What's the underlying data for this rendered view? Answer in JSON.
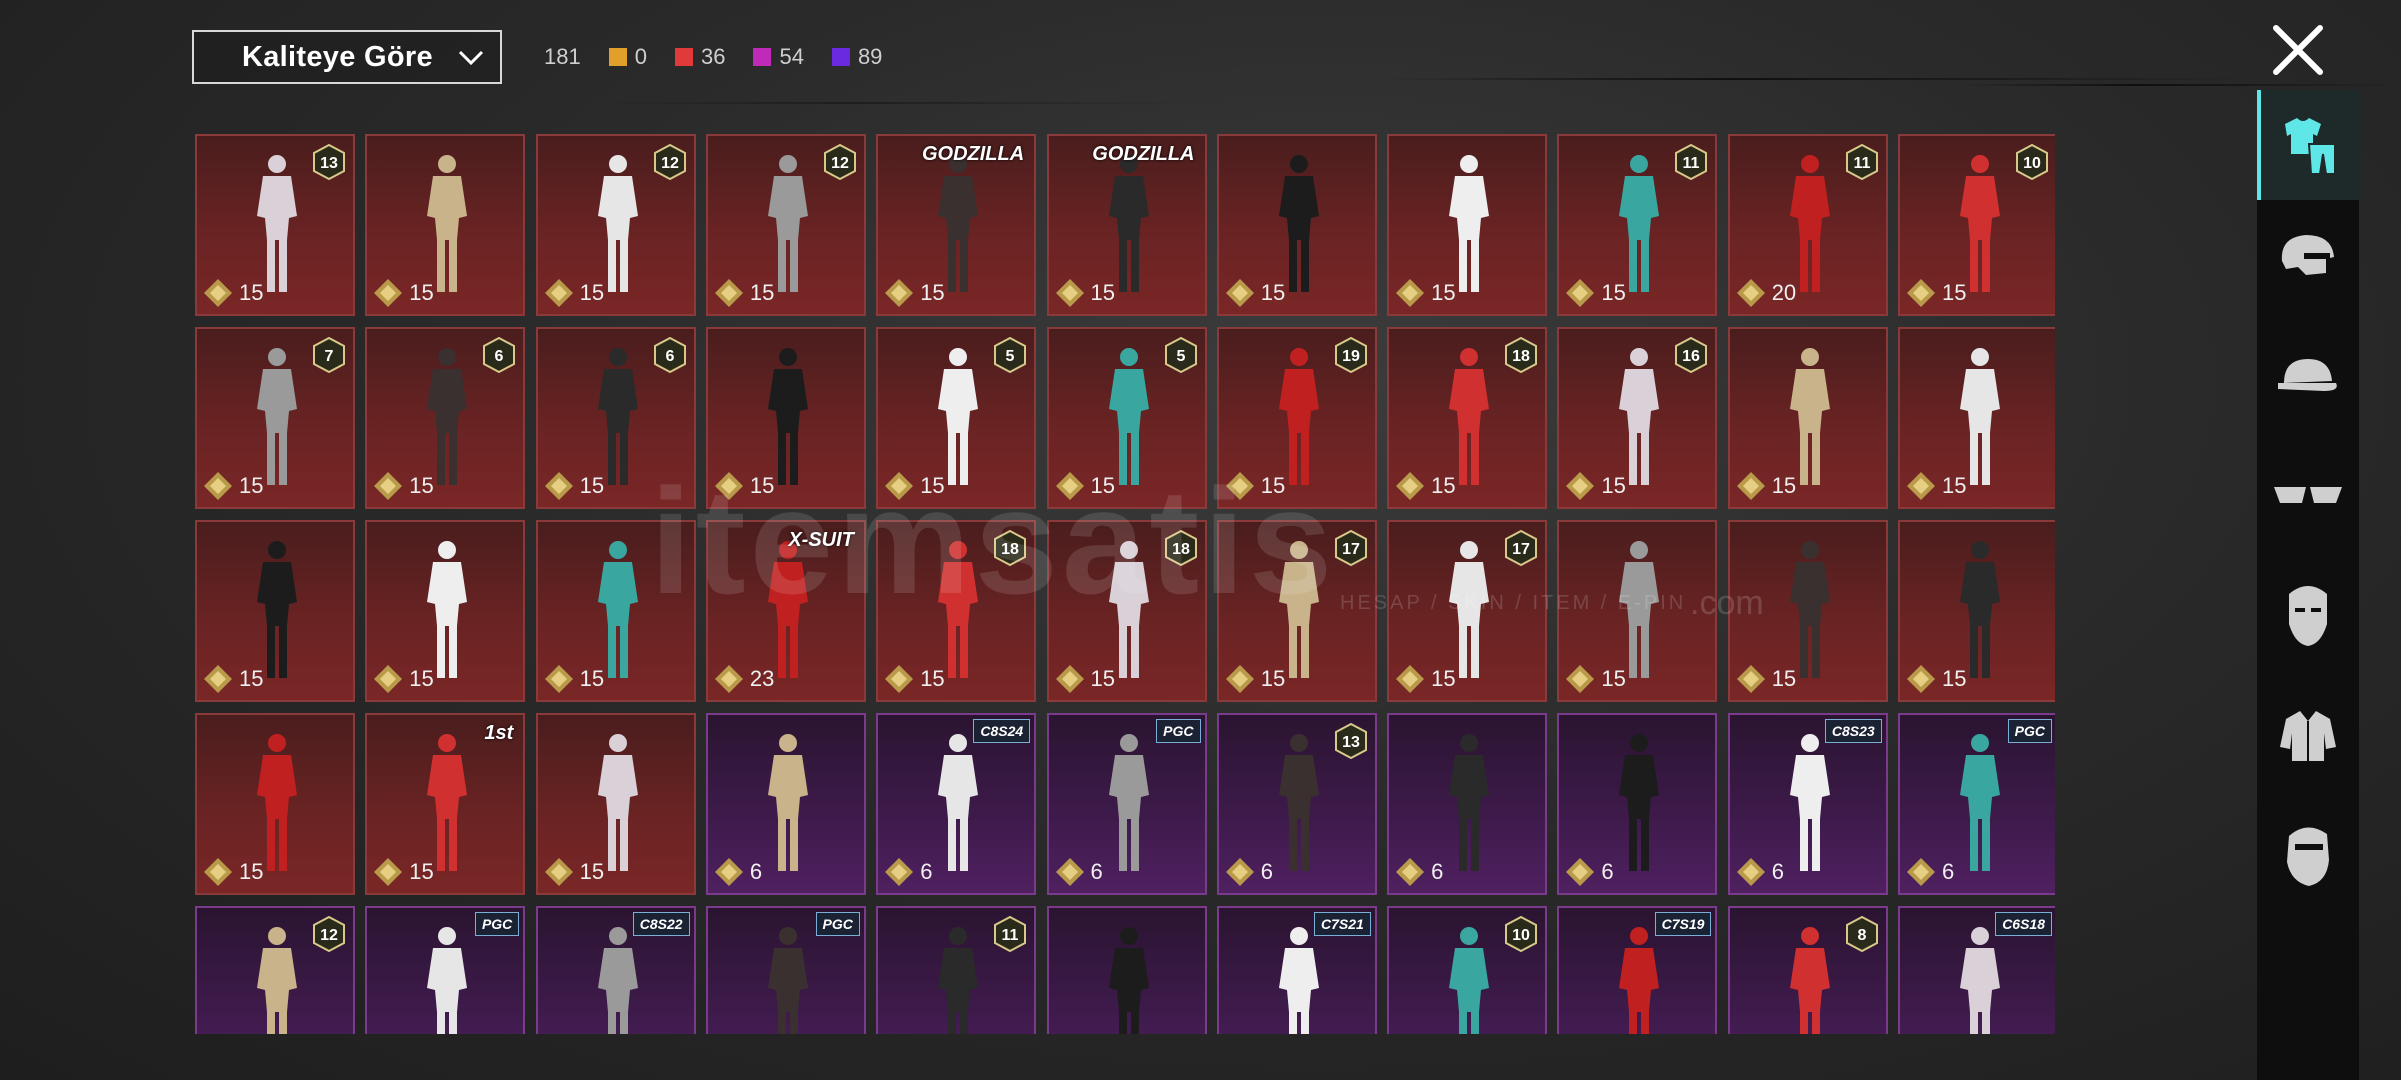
{
  "sort": {
    "label": "Kaliteye Göre"
  },
  "stats": {
    "total": "181",
    "items": [
      {
        "value": "0",
        "color": "#e0a02a"
      },
      {
        "value": "36",
        "color": "#e03a3a"
      },
      {
        "value": "54",
        "color": "#c02ab8"
      },
      {
        "value": "89",
        "color": "#6a2ae0"
      }
    ]
  },
  "watermark": {
    "brand": "itemsatis",
    "tagline": "HESAP / SKIN / ITEM / E-PIN",
    "domain": ".com"
  },
  "grid": {
    "rows": [
      [
        {
          "count": "15",
          "level": "13",
          "tier": "red"
        },
        {
          "count": "15",
          "tier": "red"
        },
        {
          "count": "15",
          "level": "12",
          "tier": "red"
        },
        {
          "count": "15",
          "level": "12",
          "tier": "red"
        },
        {
          "count": "15",
          "tag": "GODZILLA",
          "tier": "red"
        },
        {
          "count": "15",
          "tag": "GODZILLA",
          "tier": "red"
        },
        {
          "count": "15",
          "tier": "red"
        },
        {
          "count": "15",
          "tier": "red"
        },
        {
          "count": "15",
          "level": "11",
          "tier": "red"
        },
        {
          "count": "20",
          "level": "11",
          "tier": "red"
        },
        {
          "count": "15",
          "level": "10",
          "tier": "red"
        }
      ],
      [
        {
          "count": "15",
          "level": "7",
          "tier": "red"
        },
        {
          "count": "15",
          "level": "6",
          "tier": "red"
        },
        {
          "count": "15",
          "level": "6",
          "tier": "red"
        },
        {
          "count": "15",
          "tier": "red"
        },
        {
          "count": "15",
          "level": "5",
          "tier": "red"
        },
        {
          "count": "15",
          "level": "5",
          "tier": "red"
        },
        {
          "count": "15",
          "level": "19",
          "tier": "red"
        },
        {
          "count": "15",
          "level": "18",
          "tier": "red"
        },
        {
          "count": "15",
          "level": "16",
          "tier": "red"
        },
        {
          "count": "15",
          "tier": "red"
        },
        {
          "count": "15",
          "tier": "red"
        }
      ],
      [
        {
          "count": "15",
          "tier": "red"
        },
        {
          "count": "15",
          "tier": "red"
        },
        {
          "count": "15",
          "tier": "red"
        },
        {
          "count": "23",
          "tag": "X-SUIT",
          "tier": "red"
        },
        {
          "count": "15",
          "level": "18",
          "tier": "red"
        },
        {
          "count": "15",
          "level": "18",
          "tier": "red"
        },
        {
          "count": "15",
          "level": "17",
          "tier": "red"
        },
        {
          "count": "15",
          "level": "17",
          "tier": "red"
        },
        {
          "count": "15",
          "tier": "red"
        },
        {
          "count": "15",
          "tier": "red"
        },
        {
          "count": "15",
          "tier": "red"
        }
      ],
      [
        {
          "count": "15",
          "tier": "red"
        },
        {
          "count": "15",
          "tag": "1st",
          "tier": "red"
        },
        {
          "count": "15",
          "tier": "red"
        },
        {
          "count": "6",
          "tier": "purple"
        },
        {
          "count": "6",
          "tag": "C8S24",
          "tier": "purple"
        },
        {
          "count": "6",
          "tag": "PGC",
          "tier": "purple"
        },
        {
          "count": "6",
          "level": "13",
          "tier": "purple"
        },
        {
          "count": "6",
          "tier": "purple"
        },
        {
          "count": "6",
          "tier": "purple"
        },
        {
          "count": "6",
          "tag": "C8S23",
          "tier": "purple"
        },
        {
          "count": "6",
          "tag": "PGC",
          "tier": "purple"
        }
      ],
      [
        {
          "count": "",
          "level": "12",
          "tier": "purple"
        },
        {
          "count": "",
          "tag": "PGC",
          "tier": "purple"
        },
        {
          "count": "",
          "tag": "C8S22",
          "tier": "purple"
        },
        {
          "count": "",
          "tag": "PGC",
          "tier": "purple"
        },
        {
          "count": "",
          "level": "11",
          "tier": "purple"
        },
        {
          "count": "",
          "tier": "purple"
        },
        {
          "count": "",
          "tag": "C7S21",
          "tier": "purple"
        },
        {
          "count": "",
          "level": "10",
          "tier": "purple"
        },
        {
          "count": "",
          "tag": "C7S19",
          "tier": "purple"
        },
        {
          "count": "",
          "level": "8",
          "tier": "purple"
        },
        {
          "count": "",
          "tag": "C6S18",
          "tier": "purple"
        }
      ]
    ]
  },
  "rail": {
    "items": [
      {
        "icon": "outfit-icon",
        "active": true
      },
      {
        "icon": "helmet-icon",
        "active": false
      },
      {
        "icon": "cap-icon",
        "active": false
      },
      {
        "icon": "glasses-icon",
        "active": false
      },
      {
        "icon": "mask-icon",
        "active": false
      },
      {
        "icon": "jacket-icon",
        "active": false
      },
      {
        "icon": "face-icon",
        "active": false
      }
    ]
  }
}
